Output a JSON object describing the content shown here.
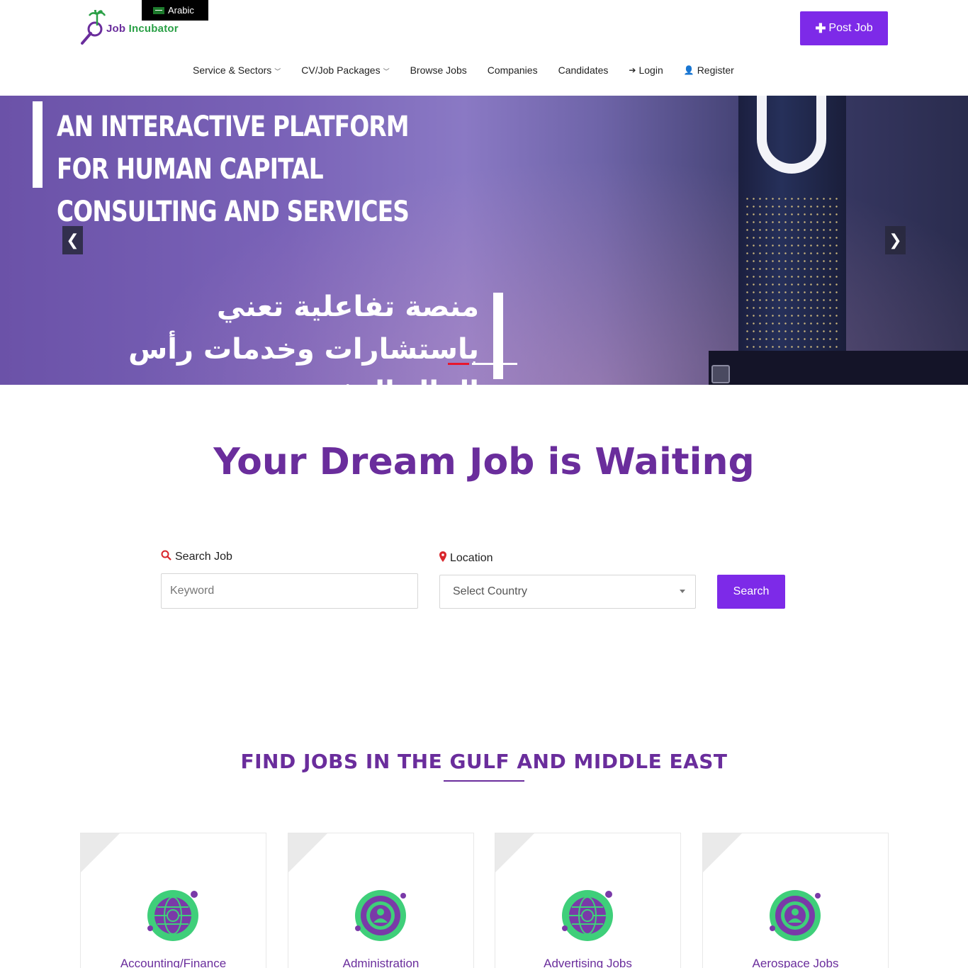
{
  "header": {
    "language_badge": "Arabic",
    "logo": {
      "word1": "Job",
      "word2": "Incubator"
    },
    "post_job_label": "Post Job"
  },
  "nav": {
    "items": [
      {
        "label": "Service & Sectors",
        "dropdown": true
      },
      {
        "label": "CV/Job Packages",
        "dropdown": true
      },
      {
        "label": "Browse Jobs",
        "dropdown": false
      },
      {
        "label": "Companies",
        "dropdown": false
      },
      {
        "label": "Candidates",
        "dropdown": false
      },
      {
        "label": "Login",
        "icon": "login-icon"
      },
      {
        "label": "Register",
        "icon": "user-plus-icon"
      }
    ]
  },
  "hero": {
    "title_en": "An Interactive Platform for Human Capital Consulting and Services",
    "title_ar": "منصة تفاعلية تعني باستشارات وخدمات رأس المال البشري",
    "slides": 3,
    "active_slide": 1
  },
  "search": {
    "heading": "Your Dream Job is Waiting",
    "keyword_label": "Search Job",
    "keyword_placeholder": "Keyword",
    "location_label": "Location",
    "country_selected": "Select Country",
    "search_button": "Search"
  },
  "find_jobs": {
    "heading": "FIND JOBS IN THE GULF AND MIDDLE EAST",
    "categories": [
      {
        "label": "Accounting/Finance",
        "icon": "globe-dollar-icon"
      },
      {
        "label": "Administration",
        "icon": "gear-person-icon"
      },
      {
        "label": "Advertising Jobs",
        "icon": "globe-dollar-icon"
      },
      {
        "label": "Aerospace Jobs",
        "icon": "gear-person-icon"
      }
    ]
  },
  "colors": {
    "brand_purple": "#6a2d9c",
    "button_purple": "#7d2ae8",
    "brand_green": "#2aa046",
    "accent_red": "#d9252c"
  }
}
